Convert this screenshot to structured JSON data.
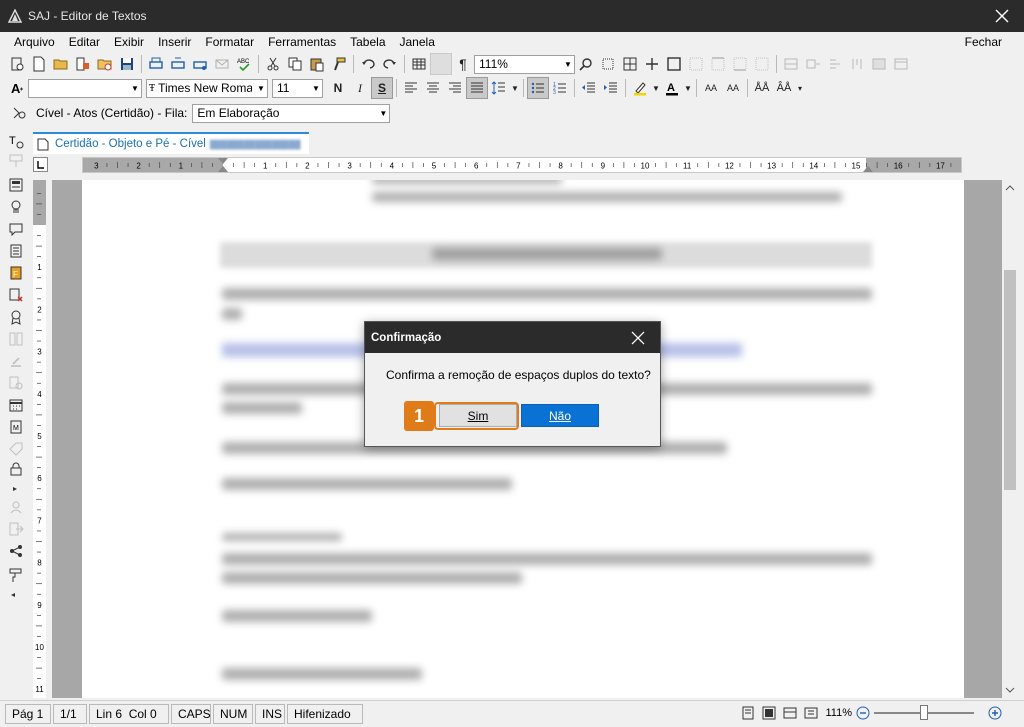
{
  "window": {
    "title": "SAJ - Editor de Textos"
  },
  "menu": {
    "items": [
      "Arquivo",
      "Editar",
      "Exibir",
      "Inserir",
      "Formatar",
      "Ferramentas",
      "Tabela",
      "Janela"
    ],
    "close_label": "Fechar"
  },
  "toolbar1": {
    "zoom_value": "111%"
  },
  "toolbar2": {
    "font_name": "Times New Roman",
    "font_size": "11",
    "bold": "N",
    "italic": "I",
    "underline": "S"
  },
  "toolbar3": {
    "document_type": "Cível - Atos (Certidão) - Fila:",
    "queue_value": "Em Elaboração"
  },
  "tab": {
    "label": "Certidão - Objeto e Pé - Cível"
  },
  "ruler": {
    "left_numbers": [
      "3",
      "2",
      "1"
    ],
    "numbers": [
      "1",
      "2",
      "3",
      "4",
      "5",
      "6",
      "7",
      "8",
      "9",
      "10",
      "11",
      "12",
      "13",
      "14",
      "15",
      "16",
      "17"
    ]
  },
  "dialog": {
    "title": "Confirmação",
    "message": "Confirma a remoção de espaços duplos do texto?",
    "yes_label": "Sim",
    "no_label": "Não"
  },
  "annotation": {
    "step": "1"
  },
  "status": {
    "page": "Pág 1",
    "pages": "1/1",
    "position": "Lin 6  Col 0",
    "caps": "CAPS",
    "num": "NUM",
    "ins": "INS",
    "hyphen": "Hifenizado",
    "zoom": "111%"
  },
  "colors": {
    "accent": "#0b72d5",
    "highlight": "#e07b1a",
    "titlebar": "#2b2b2b"
  }
}
